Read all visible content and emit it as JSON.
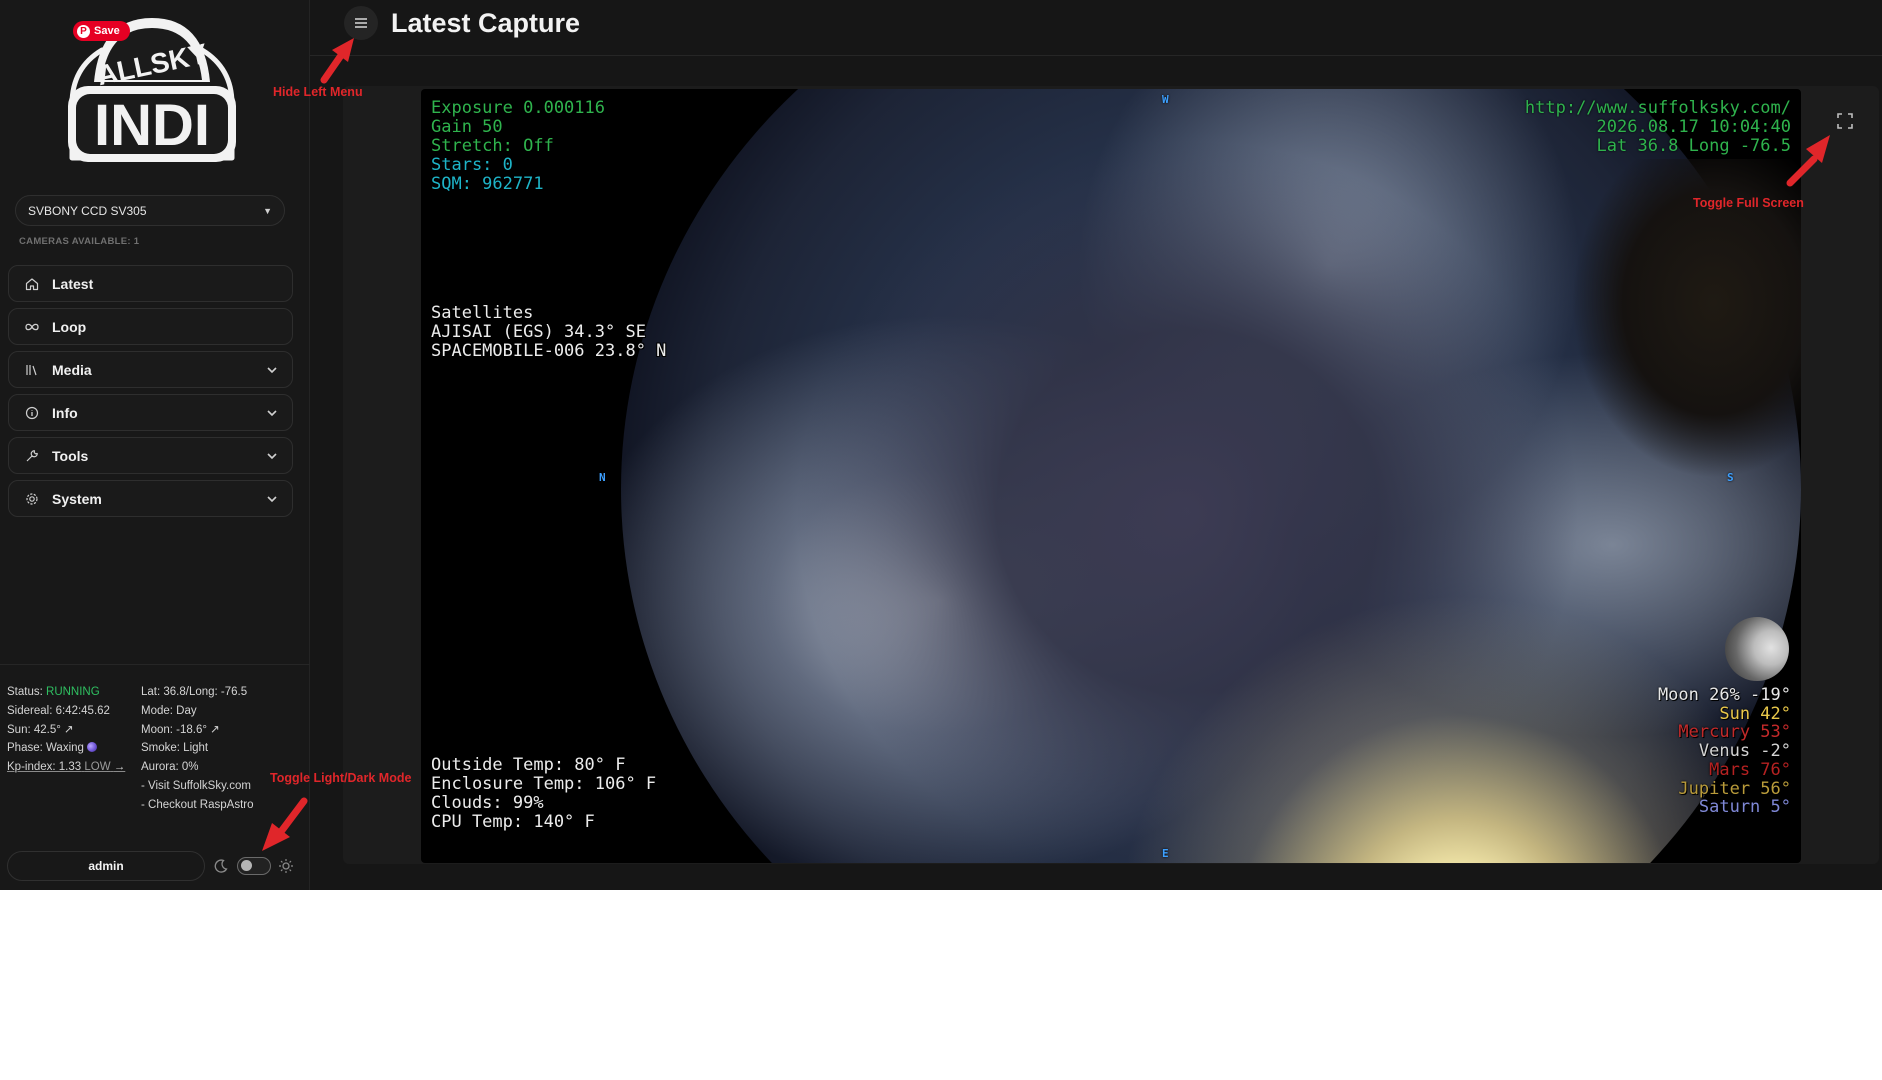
{
  "sidebar": {
    "pin_save_label": "Save",
    "camera_select_value": "SVBONY CCD SV305",
    "cameras_available": "CAMERAS AVAILABLE: 1",
    "nav": {
      "latest": "Latest",
      "loop": "Loop",
      "media": "Media",
      "info": "Info",
      "tools": "Tools",
      "system": "System"
    },
    "status": {
      "status_label": "Status:",
      "status_value": "RUNNING",
      "sidereal": "Sidereal: 6:42:45.62",
      "sun": "Sun: 42.5° ↗",
      "phase": "Phase: Waxing",
      "kp_label": "Kp-index: 1.33",
      "kp_level": "LOW",
      "kp_trend": "→",
      "latlong": "Lat: 36.8/Long: -76.5",
      "mode": "Mode: Day",
      "moon": "Moon: -18.6° ↗",
      "smoke": "Smoke: Light",
      "aurora": "Aurora: 0%",
      "link_suffolk": "- Visit SuffolkSky.com",
      "link_raspastro": "- Checkout RaspAstro"
    },
    "user": "admin"
  },
  "header": {
    "title": "Latest Capture"
  },
  "capture": {
    "top_left": [
      "Exposure 0.000116",
      "Gain 50",
      "Stretch: Off",
      "Stars: 0",
      "SQM: 962771"
    ],
    "top_right": [
      "http://www.suffolksky.com/",
      "2026.08.17 10:04:40",
      "Lat 36.8 Long -76.5"
    ],
    "satellites": [
      "Satellites",
      "AJISAI (EGS) 34.3° SE",
      "SPACEMOBILE-006 23.8° N"
    ],
    "temps": [
      "Outside Temp: 80° F",
      "Enclosure Temp: 106° F",
      "Clouds: 99%",
      "CPU Temp: 140° F"
    ],
    "planets": [
      {
        "text": "Moon 26% -19°",
        "color": "#e8e8e8"
      },
      {
        "text": "Sun 42°",
        "color": "#e9c84a"
      },
      {
        "text": "Mercury 53°",
        "color": "#c42a2a"
      },
      {
        "text": "Venus -2°",
        "color": "#d4d4d4"
      },
      {
        "text": "Mars 76°",
        "color": "#b52121"
      },
      {
        "text": "Jupiter 56°",
        "color": "#b99b3a"
      },
      {
        "text": "Saturn 5°",
        "color": "#7f88d6"
      }
    ],
    "compass": {
      "w": "W",
      "n": "N",
      "s": "S",
      "e": "E"
    }
  },
  "annotations": {
    "hide_menu": "Hide Left Menu",
    "toggle_fullscreen": "Toggle Full Screen",
    "toggle_mode": "Toggle Light/Dark Mode"
  },
  "icons": {
    "logo": "allsky-indi-logo",
    "menu": "hamburger-icon",
    "fullscreen": "expand-icon",
    "theme_dark": "moon-icon",
    "theme_light": "sun-icon"
  },
  "colors": {
    "accent_running": "#2fbf61",
    "annotation_red": "#e0262a",
    "overlay_green": "#2fb34d",
    "overlay_cyan": "#1eb4c8"
  }
}
